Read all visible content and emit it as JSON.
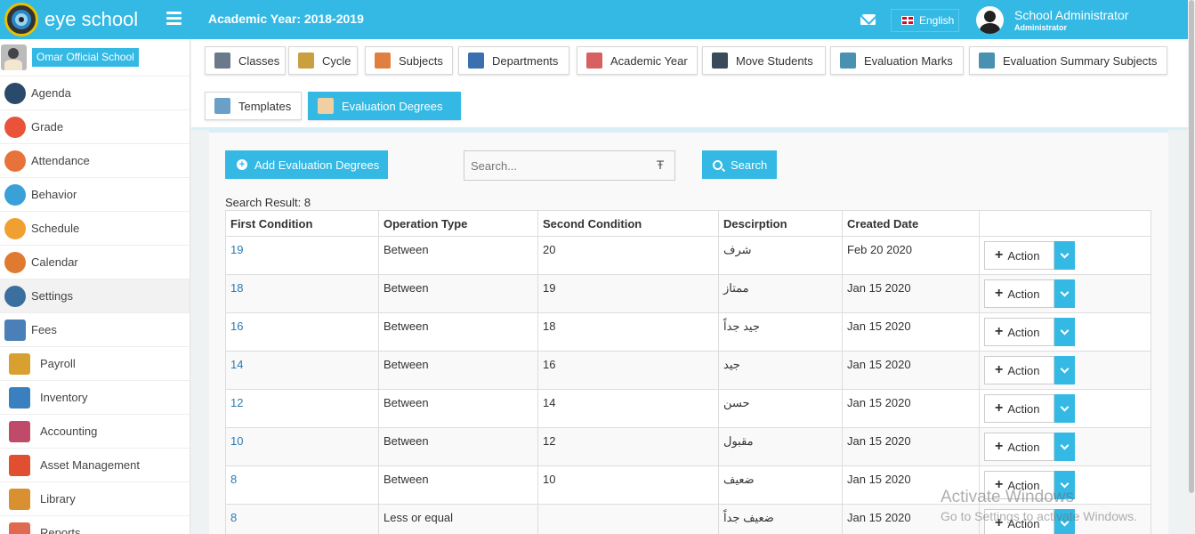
{
  "header": {
    "brand": "eye school",
    "academic_year": "Academic Year: 2018-2019",
    "language": "English",
    "user_name": "School Administrator",
    "user_role": "Administrator"
  },
  "sidebar": {
    "school_name": "Omar Official School",
    "items": [
      {
        "label": "Agenda",
        "icon": "agenda-icon",
        "color": "#2a4a6b"
      },
      {
        "label": "Grade",
        "icon": "grade-icon",
        "color": "#e8533a"
      },
      {
        "label": "Attendance",
        "icon": "attendance-icon",
        "color": "#e8733a"
      },
      {
        "label": "Behavior",
        "icon": "behavior-icon",
        "color": "#3aa0d8"
      },
      {
        "label": "Schedule",
        "icon": "schedule-icon",
        "color": "#f0a030"
      },
      {
        "label": "Calendar",
        "icon": "calendar-icon",
        "color": "#e07a30"
      },
      {
        "label": "Settings",
        "icon": "settings-icon",
        "color": "#3a6fa0"
      },
      {
        "label": "Fees",
        "icon": "fees-icon",
        "color": "#4a7fb8"
      },
      {
        "label": "Payroll",
        "icon": "payroll-icon",
        "color": "#d8a030"
      },
      {
        "label": "Inventory",
        "icon": "inventory-icon",
        "color": "#3a80c0"
      },
      {
        "label": "Accounting",
        "icon": "accounting-icon",
        "color": "#c04a6a"
      },
      {
        "label": "Asset Management",
        "icon": "asset-management-icon",
        "color": "#e05030"
      },
      {
        "label": "Library",
        "icon": "library-icon",
        "color": "#d89030"
      },
      {
        "label": "Reports",
        "icon": "reports-icon",
        "color": "#e06a50"
      }
    ]
  },
  "tabs": [
    {
      "label": "Classes",
      "icon": "classes-icon",
      "color": "#6a7a8a"
    },
    {
      "label": "Cycle",
      "icon": "cycle-icon",
      "color": "#c8a040"
    },
    {
      "label": "Subjects",
      "icon": "subjects-icon",
      "color": "#e08040"
    },
    {
      "label": "Departments",
      "icon": "departments-icon",
      "color": "#3a70b0"
    },
    {
      "label": "Academic Year",
      "icon": "academic-year-icon",
      "color": "#d86060"
    },
    {
      "label": "Move Students",
      "icon": "move-students-icon",
      "color": "#3a4a5a"
    },
    {
      "label": "Evaluation Marks",
      "icon": "evaluation-marks-icon",
      "color": "#4a90b0"
    },
    {
      "label": "Evaluation Summary Subjects",
      "icon": "evaluation-summary-icon",
      "color": "#4a90b0"
    },
    {
      "label": "Templates",
      "icon": "templates-icon",
      "color": "#6aa0c8"
    },
    {
      "label": "Evaluation Degrees",
      "icon": "evaluation-degrees-icon",
      "color": "#f0d0a0"
    }
  ],
  "toolbar": {
    "add_label": "Add Evaluation Degrees",
    "search_placeholder": "Search...",
    "search_label": "Search",
    "result_text": "Search Result: 8"
  },
  "table": {
    "columns": [
      "First Condition",
      "Operation Type",
      "Second Condition",
      "Descirption",
      "Created Date",
      ""
    ],
    "action_label": "Action",
    "rows": [
      {
        "first": "19",
        "op": "Between",
        "second": "20",
        "desc": "شرف",
        "date": "Feb 20 2020"
      },
      {
        "first": "18",
        "op": "Between",
        "second": "19",
        "desc": "ممتاز",
        "date": "Jan 15 2020"
      },
      {
        "first": "16",
        "op": "Between",
        "second": "18",
        "desc": "جيد جداً",
        "date": "Jan 15 2020"
      },
      {
        "first": "14",
        "op": "Between",
        "second": "16",
        "desc": "جيد",
        "date": "Jan 15 2020"
      },
      {
        "first": "12",
        "op": "Between",
        "second": "14",
        "desc": "حسن",
        "date": "Jan 15 2020"
      },
      {
        "first": "10",
        "op": "Between",
        "second": "12",
        "desc": "مقبول",
        "date": "Jan 15 2020"
      },
      {
        "first": "8",
        "op": "Between",
        "second": "10",
        "desc": "ضعيف",
        "date": "Jan 15 2020"
      },
      {
        "first": "8",
        "op": "Less or equal",
        "second": "",
        "desc": "ضعيف جداً",
        "date": "Jan 15 2020"
      }
    ]
  },
  "watermark": {
    "line1": "Activate Windows",
    "line2": "Go to Settings to activate Windows."
  }
}
